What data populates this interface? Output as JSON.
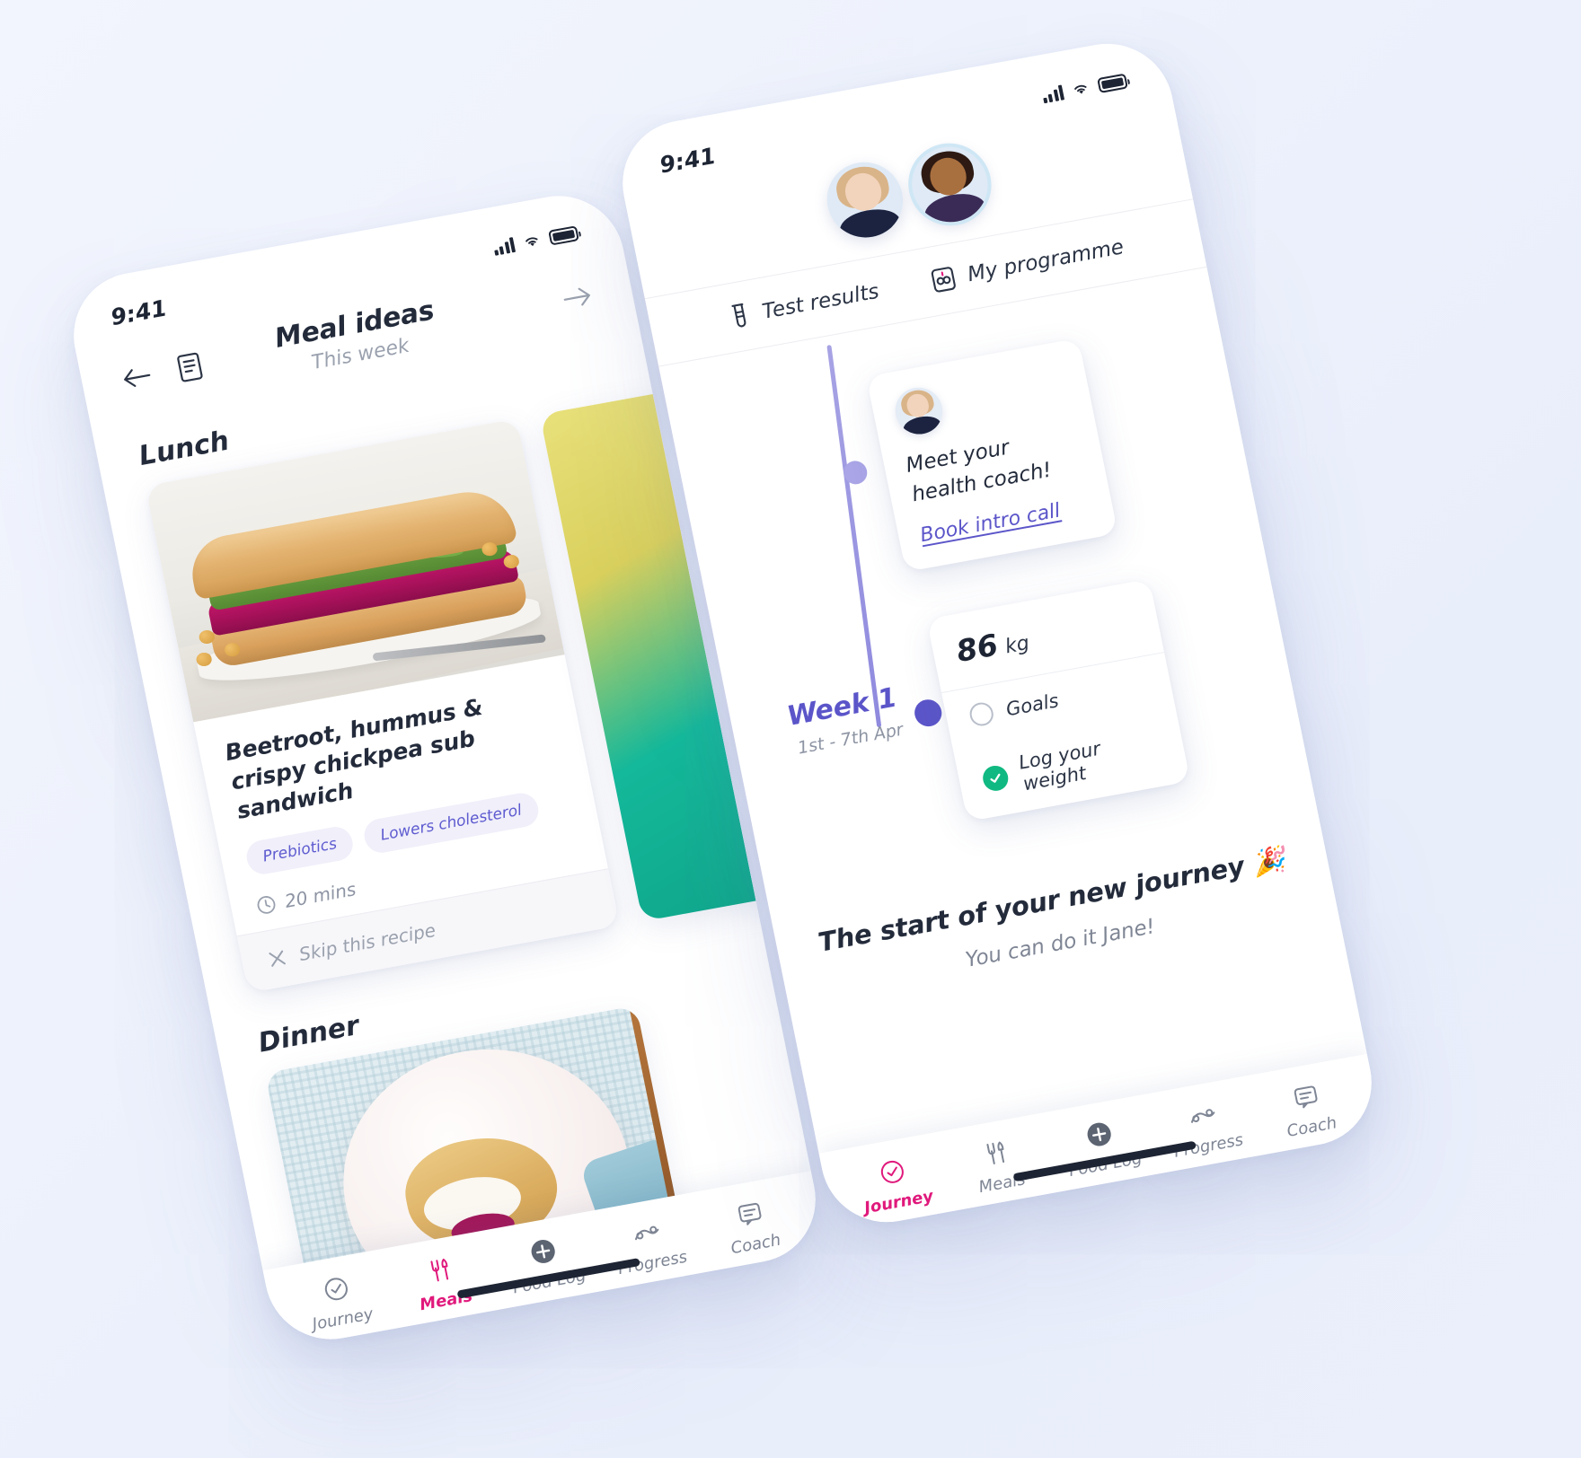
{
  "background": {
    "gradient_from": "#f2f5fd",
    "gradient_to": "#eaeffb"
  },
  "theme": {
    "accent_purple": "#5b55c9",
    "accent_pink": "#e0197c",
    "accent_green": "#10b981",
    "text_dark": "#232b3b",
    "text_muted": "#8d94a3",
    "tag_bg": "#f0effa",
    "tag_text": "#5e5bd0"
  },
  "phone_meals": {
    "status": {
      "time": "9:41",
      "signal_icon": "signal-bars-icon",
      "wifi_icon": "wifi-icon",
      "battery_icon": "battery-icon"
    },
    "header": {
      "back_icon": "arrow-left-icon",
      "list_icon": "recipe-list-icon",
      "title": "Meal ideas",
      "subtitle": "This week",
      "forward_icon": "arrow-right-icon"
    },
    "sections": [
      {
        "title": "Lunch"
      },
      {
        "title": "Dinner"
      }
    ],
    "recipe": {
      "title": "Beetroot, hummus & crispy chickpea sub sandwich",
      "tags": [
        "Prebiotics",
        "Lowers cholesterol"
      ],
      "time_icon": "clock-icon",
      "time": "20 mins",
      "skip_icon": "close-x-icon",
      "skip_label": "Skip this recipe"
    },
    "tabbar": [
      {
        "label": "Journey",
        "icon": "check-circle-icon",
        "active": false
      },
      {
        "label": "Meals",
        "icon": "cutlery-icon",
        "active": true
      },
      {
        "label": "Food Log",
        "icon": "plus-circle-icon",
        "active": false
      },
      {
        "label": "Progress",
        "icon": "progress-chart-icon",
        "active": false
      },
      {
        "label": "Coach",
        "icon": "chat-message-icon",
        "active": false
      }
    ]
  },
  "phone_journey": {
    "status": {
      "time": "9:41",
      "signal_icon": "signal-bars-icon",
      "wifi_icon": "wifi-icon",
      "battery_icon": "battery-icon"
    },
    "avatars": [
      {
        "name": "avatar-user"
      },
      {
        "name": "avatar-coach-selected"
      }
    ],
    "segmented": [
      {
        "label": "Test results",
        "icon": "test-tube-icon"
      },
      {
        "label": "My programme",
        "icon": "programme-calendar-icon"
      }
    ],
    "coach_card": {
      "avatar": "coach-avatar",
      "message": "Meet your health coach!",
      "link_label": "Book intro call"
    },
    "week": {
      "title": "Week 1",
      "dates": "1st - 7th Apr"
    },
    "stats": {
      "weight_value": "86",
      "weight_unit": "kg",
      "goals": [
        {
          "label": "Goals",
          "state": "empty"
        },
        {
          "label": "Log your weight",
          "state": "done"
        }
      ]
    },
    "footer": {
      "title": "The start of your new journey 🎉",
      "subtitle": "You can do it Jane!"
    },
    "tabbar": [
      {
        "label": "Journey",
        "icon": "check-circle-icon",
        "active": true
      },
      {
        "label": "Meals",
        "icon": "cutlery-icon",
        "active": false
      },
      {
        "label": "Food Log",
        "icon": "plus-circle-icon",
        "active": false
      },
      {
        "label": "Progress",
        "icon": "progress-chart-icon",
        "active": false
      },
      {
        "label": "Coach",
        "icon": "chat-message-icon",
        "active": false
      }
    ]
  }
}
